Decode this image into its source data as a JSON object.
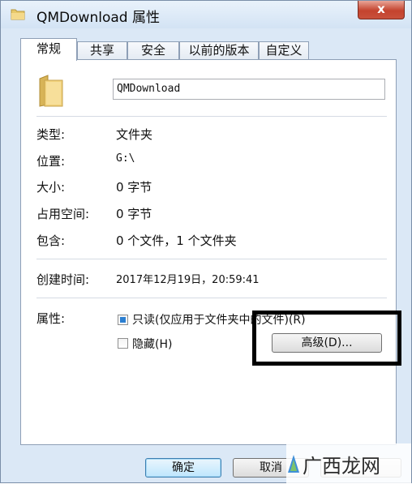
{
  "window": {
    "title": "QMDownload 属性",
    "close_label": "x"
  },
  "tabs": [
    {
      "label": "常规",
      "active": true
    },
    {
      "label": "共享",
      "active": false
    },
    {
      "label": "安全",
      "active": false
    },
    {
      "label": "以前的版本",
      "active": false
    },
    {
      "label": "自定义",
      "active": false
    }
  ],
  "general": {
    "folder_name": "QMDownload",
    "rows": [
      {
        "label": "类型:",
        "value": "文件夹"
      },
      {
        "label": "位置:",
        "value": "G:\\"
      },
      {
        "label": "大小:",
        "value": "0 字节"
      },
      {
        "label": "占用空间:",
        "value": "0 字节"
      },
      {
        "label": "包含:",
        "value": "0 个文件，1 个文件夹"
      }
    ],
    "created_label": "创建时间:",
    "created_value": "2017年12月19日，20:59:41",
    "attributes_label": "属性:",
    "readonly_label": "只读(仅应用于文件夹中的文件)(R)",
    "readonly_state": "indeterminate",
    "hidden_label": "隐藏(H)",
    "hidden_checked": false,
    "advanced_button": "高级(D)..."
  },
  "footer": {
    "ok": "确定",
    "cancel": "取消"
  },
  "watermark": {
    "text": "广西龙网"
  },
  "colors": {
    "window_bg": "#dbe8f6",
    "close_button": "#c4432e",
    "highlight_border": "#000000"
  }
}
